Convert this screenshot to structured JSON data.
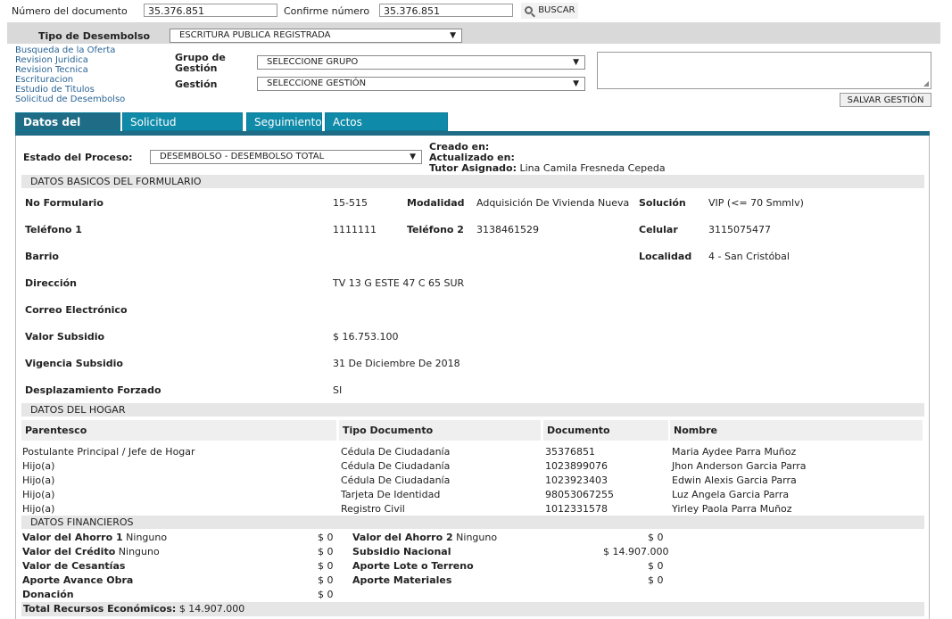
{
  "search": {
    "doc_label": "Número del documento",
    "doc_value": "35.376.851",
    "confirm_label": "Confirme número",
    "confirm_value": "35.376.851",
    "search_button": "BUSCAR"
  },
  "desembolso": {
    "tipo_label": "Tipo de Desembolso",
    "tipo_value": "ESCRITURA PUBLICA REGISTRADA"
  },
  "side_links": [
    "Busqueda de la Oferta",
    "Revision Juridica",
    "Revision Tecnica",
    "Escrituracion",
    "Estudio de Titulos",
    "Solicitud de Desembolso"
  ],
  "gestion": {
    "grupo_label_1": "Grupo de",
    "grupo_label_2": "Gestión",
    "grupo_value": "SELECCIONE GRUPO",
    "gestion_label": "Gestión",
    "gestion_value": "SELECCIONE GESTIÓN",
    "save_button": "SALVAR GESTIÓN"
  },
  "tabs": [
    "Datos del Hogar",
    "Solicitud Desembolso",
    "Seguimiento",
    "Actos Administrativos"
  ],
  "proceso": {
    "estado_label": "Estado del Proceso:",
    "estado_value": "DESEMBOLSO - DESEMBOLSO TOTAL",
    "creado": "Creado en:",
    "actualizado": "Actualizado en:",
    "tutor_label": "Tutor Asignado:",
    "tutor_value": "Lina Camila Fresneda Cepeda"
  },
  "basicos": {
    "section": "DATOS BASICOS DEL FORMULARIO",
    "no_form_label": "No Formulario",
    "no_form": "15-515",
    "modalidad_label": "Modalidad",
    "modalidad": "Adquisición De Vivienda Nueva",
    "solucion_label": "Solución",
    "solucion": "VIP (<= 70 Smmlv)",
    "tel1_label": "Teléfono 1",
    "tel1": "1111111",
    "tel2_label": "Teléfono 2",
    "tel2": "3138461529",
    "celular_label": "Celular",
    "celular": "3115075477",
    "barrio_label": "Barrio",
    "localidad_label": "Localidad",
    "localidad": "4 - San Cristóbal",
    "direccion_label": "Dirección",
    "direccion": "TV 13 G ESTE 47 C 65 SUR",
    "correo_label": "Correo Electrónico",
    "valor_label": "Valor Subsidio",
    "valor": "$ 16.753.100",
    "vigencia_label": "Vigencia Subsidio",
    "vigencia": "31 De Diciembre De 2018",
    "desplaz_label": "Desplazamiento Forzado",
    "desplaz": "SI"
  },
  "hogar": {
    "section": "DATOS DEL HOGAR",
    "headers": [
      "Parentesco",
      "Tipo Documento",
      "Documento",
      "Nombre"
    ],
    "rows": [
      [
        "Postulante Principal / Jefe de Hogar",
        "Cédula De Ciudadanía",
        "35376851",
        "Maria Aydee Parra Muñoz"
      ],
      [
        "Hijo(a)",
        "Cédula De Ciudadanía",
        "1023899076",
        "Jhon Anderson Garcia Parra"
      ],
      [
        "Hijo(a)",
        "Cédula De Ciudadanía",
        "1023923403",
        "Edwin Alexis Garcia Parra"
      ],
      [
        "Hijo(a)",
        "Tarjeta De Identidad",
        "98053067255",
        "Luz Angela Garcia Parra"
      ],
      [
        "Hijo(a)",
        "Registro Civil",
        "1012331578",
        "Yirley Paola Parra Muñoz"
      ]
    ]
  },
  "financieros": {
    "section": "DATOS FINANCIEROS",
    "left": [
      {
        "label": "Valor del Ahorro 1",
        "extra": " Ninguno",
        "value": "$ 0"
      },
      {
        "label": "Valor del Crédito",
        "extra": " Ninguno",
        "value": "$ 0"
      },
      {
        "label": "Valor de Cesantías",
        "extra": "",
        "value": "$ 0"
      },
      {
        "label": "Aporte Avance Obra",
        "extra": "",
        "value": "$ 0"
      },
      {
        "label": "Donación",
        "extra": "",
        "value": "$ 0"
      }
    ],
    "right": [
      {
        "label": "Valor del Ahorro 2",
        "extra": " Ninguno",
        "value": "$ 0"
      },
      {
        "label": "Subsidio Nacional",
        "extra": "",
        "value": "$ 14.907.000"
      },
      {
        "label": "Aporte Lote o Terreno",
        "extra": "",
        "value": "$ 0"
      },
      {
        "label": "Aporte Materiales",
        "extra": "",
        "value": "$ 0"
      }
    ],
    "total_label": "Total Recursos Económicos:",
    "total_value": "$ 14.907.000"
  }
}
